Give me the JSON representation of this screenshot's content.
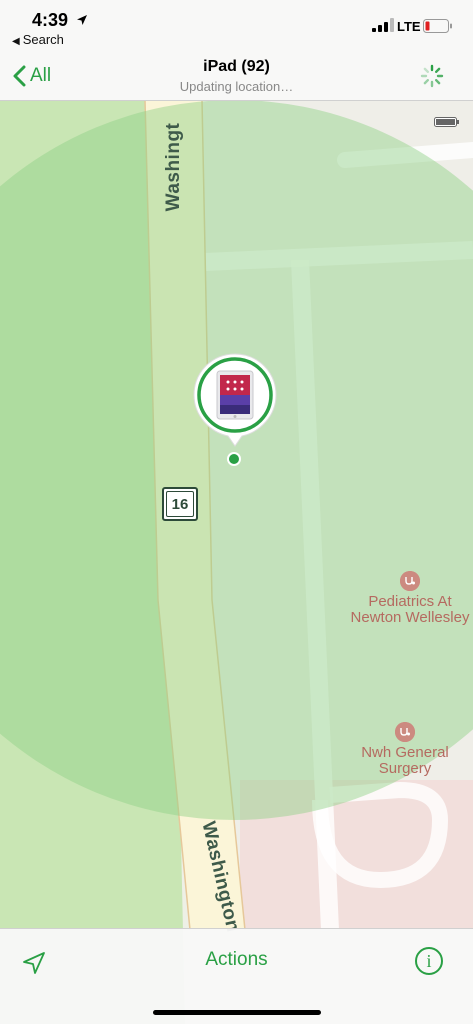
{
  "status_bar": {
    "time": "4:39",
    "back_app": "Search",
    "network": "LTE"
  },
  "nav": {
    "back_label": "All",
    "title": "iPad (92)",
    "subtitle": "Updating location…"
  },
  "map": {
    "street_name_top": "Washingt",
    "street_name_bottom": "Washington",
    "route_number": "16",
    "pois": [
      {
        "name_line1": "Pediatrics At",
        "name_line2": "Newton Wellesley",
        "icon": "medical-icon"
      },
      {
        "name_line1": "Nwh General",
        "name_line2": "Surgery",
        "icon": "medical-icon"
      }
    ],
    "accuracy_color": "#7fc77a",
    "device": "iPad"
  },
  "toolbar": {
    "actions_label": "Actions",
    "info_label": "i"
  },
  "colors": {
    "accent": "#2aa045",
    "poi": "#b56a60",
    "street_text": "#3e5a4a"
  }
}
